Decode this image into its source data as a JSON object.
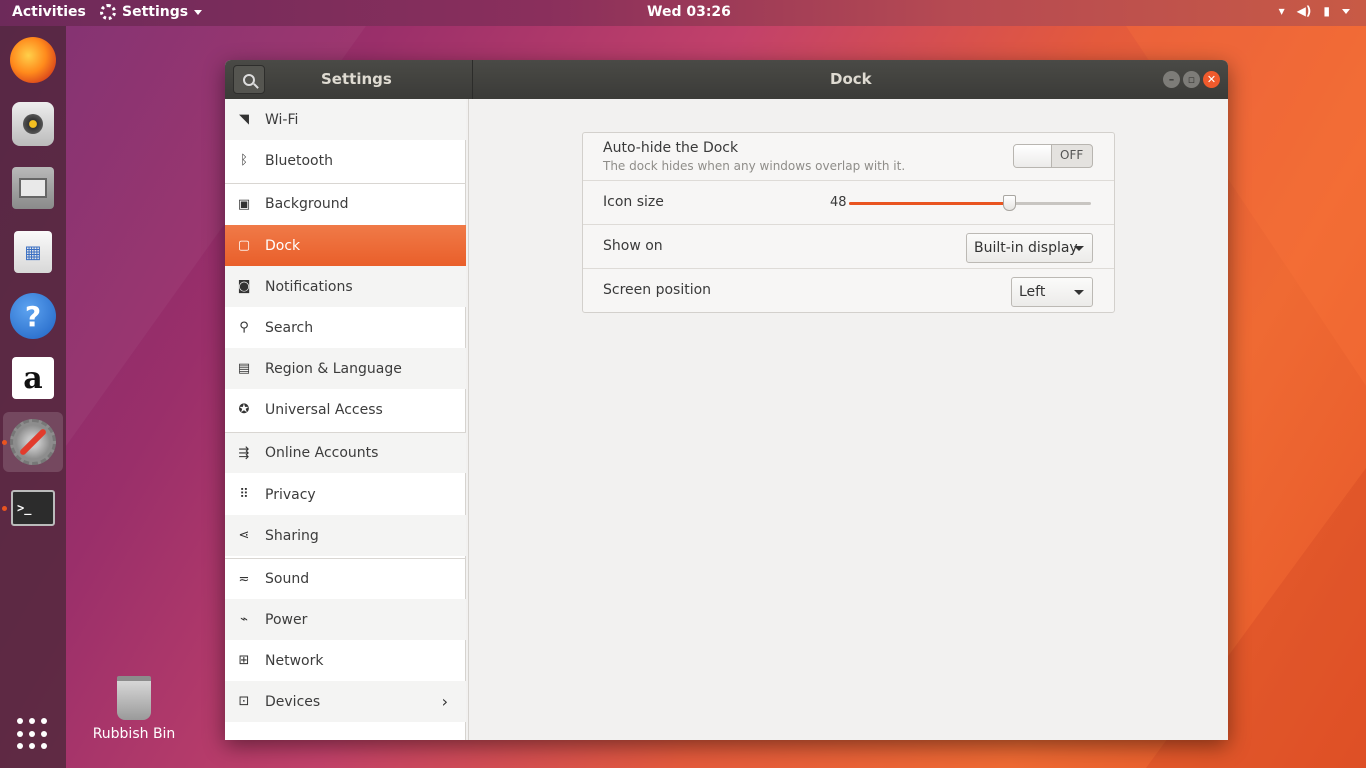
{
  "topbar": {
    "activities": "Activities",
    "app_menu": "Settings",
    "clock": "Wed 03:26"
  },
  "dock": {
    "items": [
      {
        "name": "Firefox",
        "icon": "firefox-icon"
      },
      {
        "name": "Rhythmbox",
        "icon": "rhythmbox-icon"
      },
      {
        "name": "Files",
        "icon": "files-icon"
      },
      {
        "name": "Ubuntu Software",
        "icon": "software-store-icon"
      },
      {
        "name": "Help",
        "icon": "help-icon",
        "glyph": "?"
      },
      {
        "name": "Amazon",
        "icon": "amazon-icon",
        "glyph": "a"
      },
      {
        "name": "Settings",
        "icon": "settings-icon"
      },
      {
        "name": "Terminal",
        "icon": "terminal-icon",
        "glyph": ">_"
      }
    ]
  },
  "desktop": {
    "bin_label": "Rubbish Bin"
  },
  "window": {
    "left_title": "Settings",
    "main_title": "Dock",
    "accent": "#e95420"
  },
  "sidebar": {
    "items": [
      {
        "label": "Wi-Fi",
        "icon": "wifi-icon"
      },
      {
        "label": "Bluetooth",
        "icon": "bluetooth-icon"
      },
      {
        "label": "Background",
        "icon": "background-icon"
      },
      {
        "label": "Dock",
        "icon": "dock-icon"
      },
      {
        "label": "Notifications",
        "icon": "notifications-icon"
      },
      {
        "label": "Search",
        "icon": "search-icon"
      },
      {
        "label": "Region & Language",
        "icon": "region-icon"
      },
      {
        "label": "Universal Access",
        "icon": "universal-access-icon"
      },
      {
        "label": "Online Accounts",
        "icon": "online-accounts-icon"
      },
      {
        "label": "Privacy",
        "icon": "privacy-icon"
      },
      {
        "label": "Sharing",
        "icon": "sharing-icon"
      },
      {
        "label": "Sound",
        "icon": "sound-icon"
      },
      {
        "label": "Power",
        "icon": "power-icon"
      },
      {
        "label": "Network",
        "icon": "network-icon"
      },
      {
        "label": "Devices",
        "icon": "devices-icon"
      }
    ]
  },
  "dock_settings": {
    "autohide": {
      "title": "Auto-hide the Dock",
      "description": "The dock hides when any windows overlap with it.",
      "state": "OFF"
    },
    "icon_size": {
      "label": "Icon size",
      "value": "48",
      "fraction": 0.66
    },
    "show_on": {
      "label": "Show on",
      "value": "Built-in display"
    },
    "screen_position": {
      "label": "Screen position",
      "value": "Left"
    }
  }
}
